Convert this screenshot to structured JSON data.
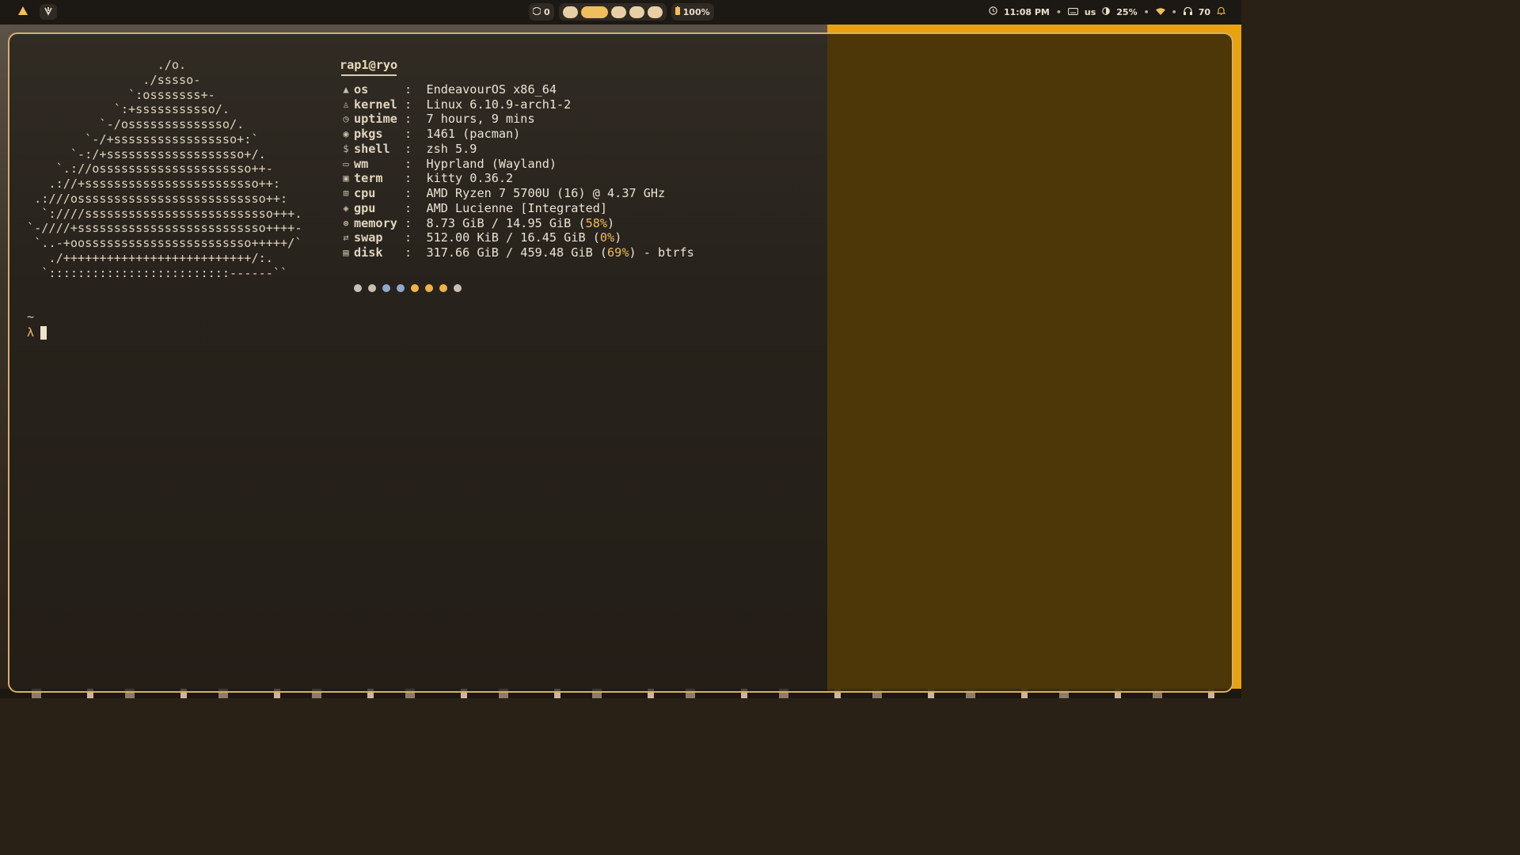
{
  "topbar": {
    "workspace_count": "0",
    "battery": "100%",
    "clock": "11:08 PM",
    "keyboard_layout": "us",
    "brightness": "25%",
    "volume": "70",
    "separator": "•"
  },
  "fetch": {
    "logo": [
      "                  ./o.",
      "                ./sssso-",
      "              `:osssssss+-",
      "            `:+sssssssssso/.",
      "          `-/ossssssssssssso/.",
      "        `-/+sssssssssssssssso+:`",
      "      `-:/+sssssssssssssssssso+/.",
      "    `.://osssssssssssssssssssso++-",
      "   .://+ssssssssssssssssssssssso++:",
      " .:///ossssssssssssssssssssssssso++:",
      "  `:////ssssssssssssssssssssssssso+++.",
      "`-////+ssssssssssssssssssssssssso++++-",
      " `..-+oosssssssssssssssssssssso+++++/`",
      "   ./++++++++++++++++++++++++++/:.",
      "  `:::::::::::::::::::::::::------``"
    ],
    "title": "rap1@ryo",
    "rows": [
      {
        "icon": "arch-icon",
        "key": "os",
        "value": "EndeavourOS x86_64"
      },
      {
        "icon": "linux-icon",
        "key": "kernel",
        "value": "Linux 6.10.9-arch1-2"
      },
      {
        "icon": "clock-icon",
        "key": "uptime",
        "value": "7 hours, 9 mins"
      },
      {
        "icon": "package-icon",
        "key": "pkgs",
        "value": "1461 (pacman)"
      },
      {
        "icon": "dollar-icon",
        "key": "shell",
        "value": "zsh 5.9"
      },
      {
        "icon": "window-icon",
        "key": "wm",
        "value": "Hyprland (Wayland)"
      },
      {
        "icon": "terminal-icon",
        "key": "term",
        "value": "kitty 0.36.2"
      },
      {
        "icon": "cpu-icon",
        "key": "cpu",
        "value": "AMD Ryzen 7 5700U (16) @ 4.37 GHz"
      },
      {
        "icon": "gpu-icon",
        "key": "gpu",
        "value": "AMD Lucienne [Integrated]"
      },
      {
        "icon": "memory-icon",
        "key": "memory",
        "value_pre": "8.73 GiB / 14.95 GiB (",
        "value_pct": "58%",
        "value_post": ")"
      },
      {
        "icon": "swap-icon",
        "key": "swap",
        "value_pre": "512.00 KiB / 16.45 GiB (",
        "value_pct": "0%",
        "value_post": ")"
      },
      {
        "icon": "disk-icon",
        "key": "disk",
        "value_pre": "317.66 GiB / 459.48 GiB (",
        "value_pct": "69%",
        "value_post": ") - btrfs"
      }
    ],
    "palette": [
      "#c8c0b4",
      "#c8c0b4",
      "#8fa9c8",
      "#8fa9c8",
      "#f0b34a",
      "#f0b34a",
      "#f0b34a",
      "#c8c0b4"
    ]
  },
  "prompt": {
    "dir": "~",
    "symbol": "λ"
  }
}
